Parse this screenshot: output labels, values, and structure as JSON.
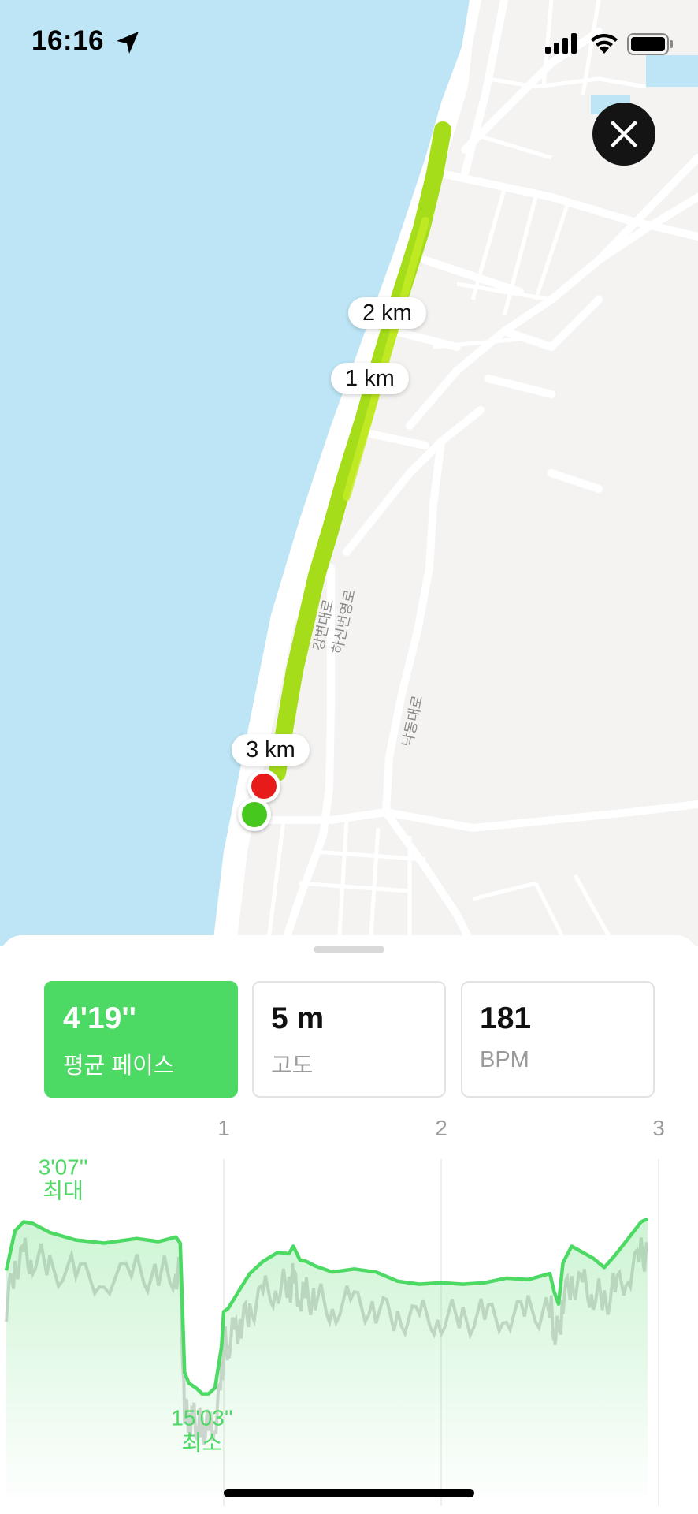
{
  "status_bar": {
    "time": "16:16"
  },
  "map": {
    "distance_markers": [
      "2 km",
      "1 km",
      "3 km"
    ],
    "road_labels": [
      "강변대로",
      "하신번영로",
      "낙동대로"
    ],
    "colors": {
      "water": "#bde5f5",
      "land": "#f4f3f1",
      "road": "#ffffff",
      "route": "#a6dd1a",
      "start": "#46c81e",
      "end": "#e81b1b"
    }
  },
  "close_button": {
    "icon": "close-icon"
  },
  "stats": [
    {
      "value": "4'19''",
      "label": "평균 페이스",
      "active": true
    },
    {
      "value": "5 m",
      "label": "고도",
      "active": false
    },
    {
      "value": "181",
      "label": "BPM",
      "active": false
    }
  ],
  "chart_data": {
    "type": "area",
    "x_ticks": [
      "1",
      "2",
      "3"
    ],
    "annotations": [
      {
        "value": "3'07''",
        "label": "최대"
      },
      {
        "value": "15'03''",
        "label": "최소"
      }
    ],
    "series": [
      {
        "x": [
          0,
          0.04,
          0.08,
          0.12,
          0.2,
          0.32,
          0.45,
          0.6,
          0.7,
          0.78,
          0.8,
          0.82,
          0.84,
          0.86,
          0.88,
          0.9,
          0.93,
          0.96,
          0.99,
          1.0,
          1.02,
          1.05,
          1.08,
          1.12,
          1.18,
          1.25,
          1.3,
          1.32,
          1.35,
          1.38,
          1.42,
          1.5,
          1.6,
          1.7,
          1.8,
          1.9,
          2.0,
          2.1,
          2.2,
          2.3,
          2.4,
          2.5,
          2.52,
          2.54,
          2.56,
          2.6,
          2.65,
          2.7,
          2.75,
          2.8,
          2.86,
          2.92,
          2.95
        ],
        "values": [
          6.8,
          4.2,
          3.6,
          3.7,
          4.3,
          4.8,
          5.0,
          4.7,
          4.9,
          4.6,
          5.0,
          13.5,
          14.2,
          14.4,
          14.6,
          14.9,
          14.9,
          14.5,
          11.8,
          9.5,
          9.3,
          8.6,
          7.9,
          7.0,
          6.2,
          5.6,
          5.7,
          5.2,
          6.1,
          6.2,
          6.5,
          6.9,
          6.7,
          6.9,
          7.5,
          7.7,
          7.6,
          7.7,
          7.6,
          7.3,
          7.4,
          7.0,
          8.2,
          9.0,
          6.3,
          5.2,
          5.6,
          6.0,
          6.6,
          5.8,
          4.7,
          3.6,
          3.4
        ]
      }
    ],
    "ylim": [
      0,
      17
    ],
    "xlim": [
      0,
      3
    ],
    "inverted_y": true,
    "color": "#4cd964"
  }
}
